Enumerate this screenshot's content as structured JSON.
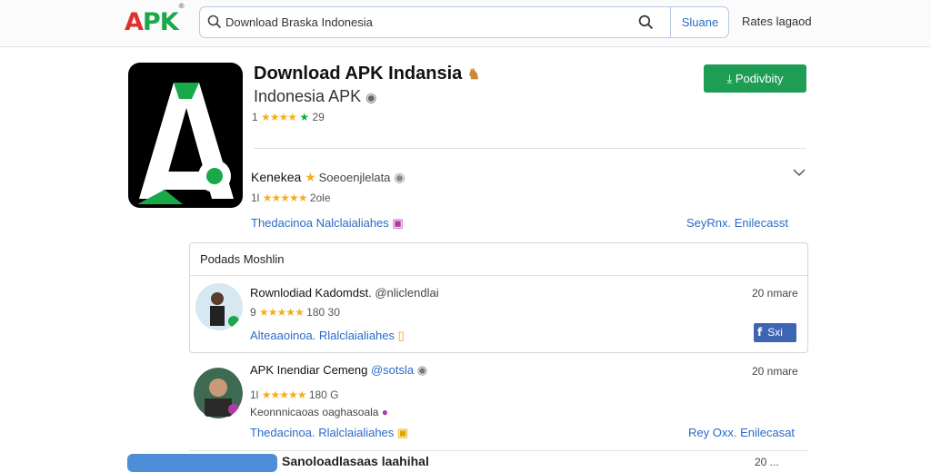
{
  "header": {
    "logo_a": "A",
    "logo_rest": "PK",
    "search_value": "Download Braska Indonesia",
    "search_button": "Sluane",
    "top_link": "Rates lagaod"
  },
  "app": {
    "title": "Download APK Indansia",
    "subtitle": "Indonesia APK",
    "rating_text": "1",
    "rating_count": "29",
    "download_button": "Podivbity"
  },
  "developer": {
    "name": "Kenekea",
    "desc": "Soeoenjlelata",
    "rating_prefix": "1l",
    "rating_count": "2ole",
    "link_left": "Thedacinoa",
    "link_mid": "Nalclaialiahes",
    "link_right": "SeyRnx. Enilecasst"
  },
  "reviews_panel": {
    "heading": "Podads Moshlin"
  },
  "reviews": [
    {
      "title": "Rownlodiad Kadomdst.",
      "handle": "@nliclendlai",
      "time": "20 nmare",
      "rating_prefix": "9",
      "count": "180 30",
      "link_left": "Alteaaoinoa.",
      "link_mid": "Rlalclaialiahes",
      "share": "Sxi"
    },
    {
      "title": "APK Inendiar Cemeng",
      "handle": "@sotsla",
      "time": "20 nmare",
      "rating_prefix": "1l",
      "count": "180 G",
      "desc": "Keonnnicaoas oaghasoala",
      "link_left": "Thedacinoa.",
      "link_mid": "Rlalclaialiahes",
      "link_right": "Rey Oxx. Enilecasat"
    }
  ],
  "bottom": {
    "title": "Sanoloadlasaas laahihal",
    "time": "20 ..."
  },
  "colors": {
    "accent_green": "#1e9e55",
    "link_blue": "#2b6bc7",
    "star": "#f2b01e"
  }
}
